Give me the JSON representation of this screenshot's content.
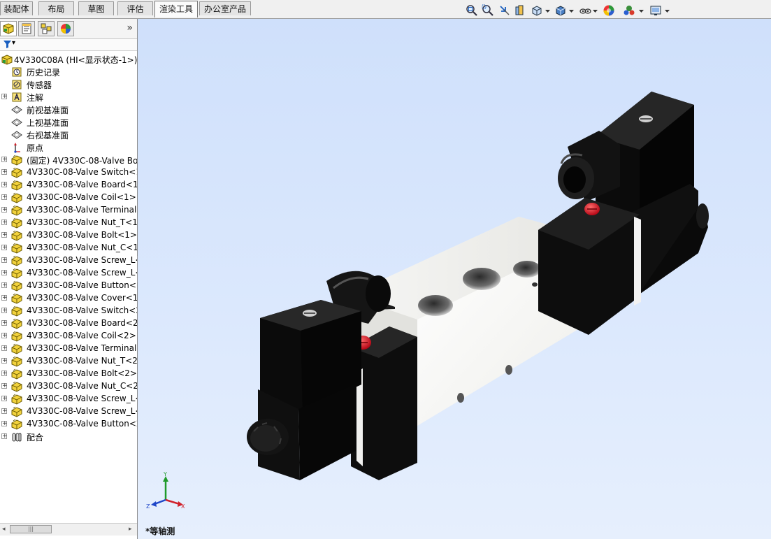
{
  "tabs": [
    {
      "label": "装配体",
      "active": false
    },
    {
      "label": "布局",
      "active": false
    },
    {
      "label": "草图",
      "active": false
    },
    {
      "label": "评估",
      "active": false
    },
    {
      "label": "渲染工具",
      "active": true
    },
    {
      "label": "办公室产品",
      "active": false
    }
  ],
  "view_toolbar": {
    "icons": [
      "zoom-to-fit-icon",
      "zoom-to-area-icon",
      "previous-view-icon",
      "section-view-icon",
      "view-orientation-icon",
      "display-style-icon",
      "hide-show-items-icon",
      "edit-appearance-icon",
      "apply-scene-icon",
      "view-settings-icon"
    ]
  },
  "panel": {
    "tabs": [
      "featuremanager-icon",
      "propertymanager-icon",
      "configurationmanager-icon",
      "displaymanager-icon"
    ],
    "collapse_glyph": "»",
    "filter_glyph": "▾"
  },
  "tree": {
    "root": "4V330C08A  (HI<显示状态-1>)",
    "items": [
      {
        "label": "历史记录",
        "icon": "history-icon",
        "expandable": false
      },
      {
        "label": "传感器",
        "icon": "sensor-icon",
        "expandable": false
      },
      {
        "label": "注解",
        "icon": "annotation-icon",
        "expandable": true
      },
      {
        "label": "前视基准面",
        "icon": "plane-icon",
        "expandable": false
      },
      {
        "label": "上视基准面",
        "icon": "plane-icon",
        "expandable": false
      },
      {
        "label": "右视基准面",
        "icon": "plane-icon",
        "expandable": false
      },
      {
        "label": "原点",
        "icon": "origin-icon",
        "expandable": false
      },
      {
        "label": "(固定) 4V330C-08-Valve Bo",
        "icon": "part-icon",
        "expandable": true
      },
      {
        "label": "4V330C-08-Valve Switch<1",
        "icon": "part-icon",
        "expandable": true
      },
      {
        "label": "4V330C-08-Valve Board<1",
        "icon": "part-icon",
        "expandable": true
      },
      {
        "label": "4V330C-08-Valve Coil<1> (",
        "icon": "part-icon",
        "expandable": true
      },
      {
        "label": "4V330C-08-Valve Terminal",
        "icon": "part-icon",
        "expandable": true
      },
      {
        "label": "4V330C-08-Valve Nut_T<1>",
        "icon": "part-icon",
        "expandable": true
      },
      {
        "label": "4V330C-08-Valve Bolt<1>",
        "icon": "part-icon",
        "expandable": true
      },
      {
        "label": "4V330C-08-Valve Nut_C<1>",
        "icon": "part-icon",
        "expandable": true
      },
      {
        "label": "4V330C-08-Valve Screw_L<",
        "icon": "part-icon",
        "expandable": true
      },
      {
        "label": "4V330C-08-Valve Screw_L<",
        "icon": "part-icon",
        "expandable": true
      },
      {
        "label": "4V330C-08-Valve Button<1",
        "icon": "part-icon",
        "expandable": true
      },
      {
        "label": "4V330C-08-Valve Cover<1>",
        "icon": "part-icon",
        "expandable": true
      },
      {
        "label": "4V330C-08-Valve Switch<2",
        "icon": "part-icon",
        "expandable": true
      },
      {
        "label": "4V330C-08-Valve Board<2",
        "icon": "part-icon",
        "expandable": true
      },
      {
        "label": "4V330C-08-Valve Coil<2> (",
        "icon": "part-icon",
        "expandable": true
      },
      {
        "label": "4V330C-08-Valve Terminal",
        "icon": "part-icon",
        "expandable": true
      },
      {
        "label": "4V330C-08-Valve Nut_T<2>",
        "icon": "part-icon",
        "expandable": true
      },
      {
        "label": "4V330C-08-Valve Bolt<2>",
        "icon": "part-icon",
        "expandable": true
      },
      {
        "label": "4V330C-08-Valve Nut_C<2>",
        "icon": "part-icon",
        "expandable": true
      },
      {
        "label": "4V330C-08-Valve Screw_L<",
        "icon": "part-icon",
        "expandable": true
      },
      {
        "label": "4V330C-08-Valve Screw_L<",
        "icon": "part-icon",
        "expandable": true
      },
      {
        "label": "4V330C-08-Valve Button<2",
        "icon": "part-icon",
        "expandable": true
      },
      {
        "label": "配合",
        "icon": "mates-icon",
        "expandable": true
      }
    ]
  },
  "scrollbar": {
    "left_arrow": "◂",
    "right_arrow": "▸",
    "grip": "|||"
  },
  "viewport": {
    "view_name": "*等轴测",
    "triad": {
      "x": "X",
      "y": "Y",
      "z": "Z"
    },
    "colors": {
      "body": "#f4f4f2",
      "coil": "#0c0c0c",
      "button": "#d8141e",
      "background_top": "#cfe0fb"
    }
  }
}
